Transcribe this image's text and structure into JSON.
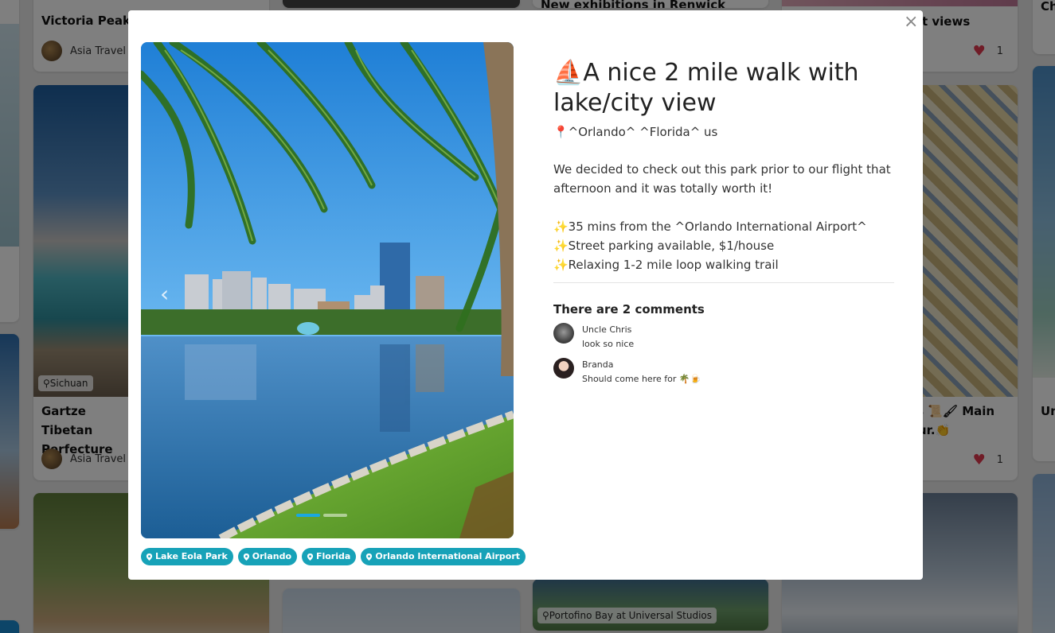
{
  "feed": {
    "cards": [
      {
        "title": "Victoria Peak 🚇",
        "author": "Asia Travel B",
        "tag": ""
      },
      {
        "title": "Gartze Tibetan Perfecture",
        "author": "Asia Travel B",
        "tag": "Sichuan"
      },
      {
        "title": "New exhibitions in Renwick Gallery",
        "author": "",
        "tag": ""
      },
      {
        "title": "t views",
        "author": "",
        "likes": "1"
      },
      {
        "title": "ess 📜🖌 Main Thur.👏",
        "author": "",
        "likes": "1"
      },
      {
        "title": "Portofino Bay at Universal Studios",
        "tag": "Portofino Bay at Universal Studios"
      },
      {
        "title": "Ch",
        "author": ""
      },
      {
        "title": "Un",
        "author": ""
      }
    ]
  },
  "modal": {
    "close_label": "×",
    "title": "⛵A nice 2 mile walk with lake/city view",
    "location": "📍^Orlando^  ^Florida^  us",
    "description": {
      "line1": "We decided to check out this park prior to our flight that afternoon and it was totally worth it!",
      "bullet1": "✨35 mins from the  ^Orlando International Airport^",
      "bullet2": "✨Street parking available, $1/house",
      "bullet3": "✨Relaxing 1-2 mile loop walking trail"
    },
    "comments_title": "There are 2 comments",
    "comments": [
      {
        "author": "Uncle Chris",
        "text": "look so nice"
      },
      {
        "author": "Branda",
        "text": "Should come here for 🌴🍺"
      }
    ],
    "prev_arrow": "‹",
    "tags": [
      "Lake Eola Park",
      "Orlando",
      "Florida",
      "Orlando International Airport"
    ],
    "colors": {
      "tag_bg": "#17a2b8",
      "dot_active": "#1aa8e0",
      "heart": "#e0394f"
    }
  }
}
